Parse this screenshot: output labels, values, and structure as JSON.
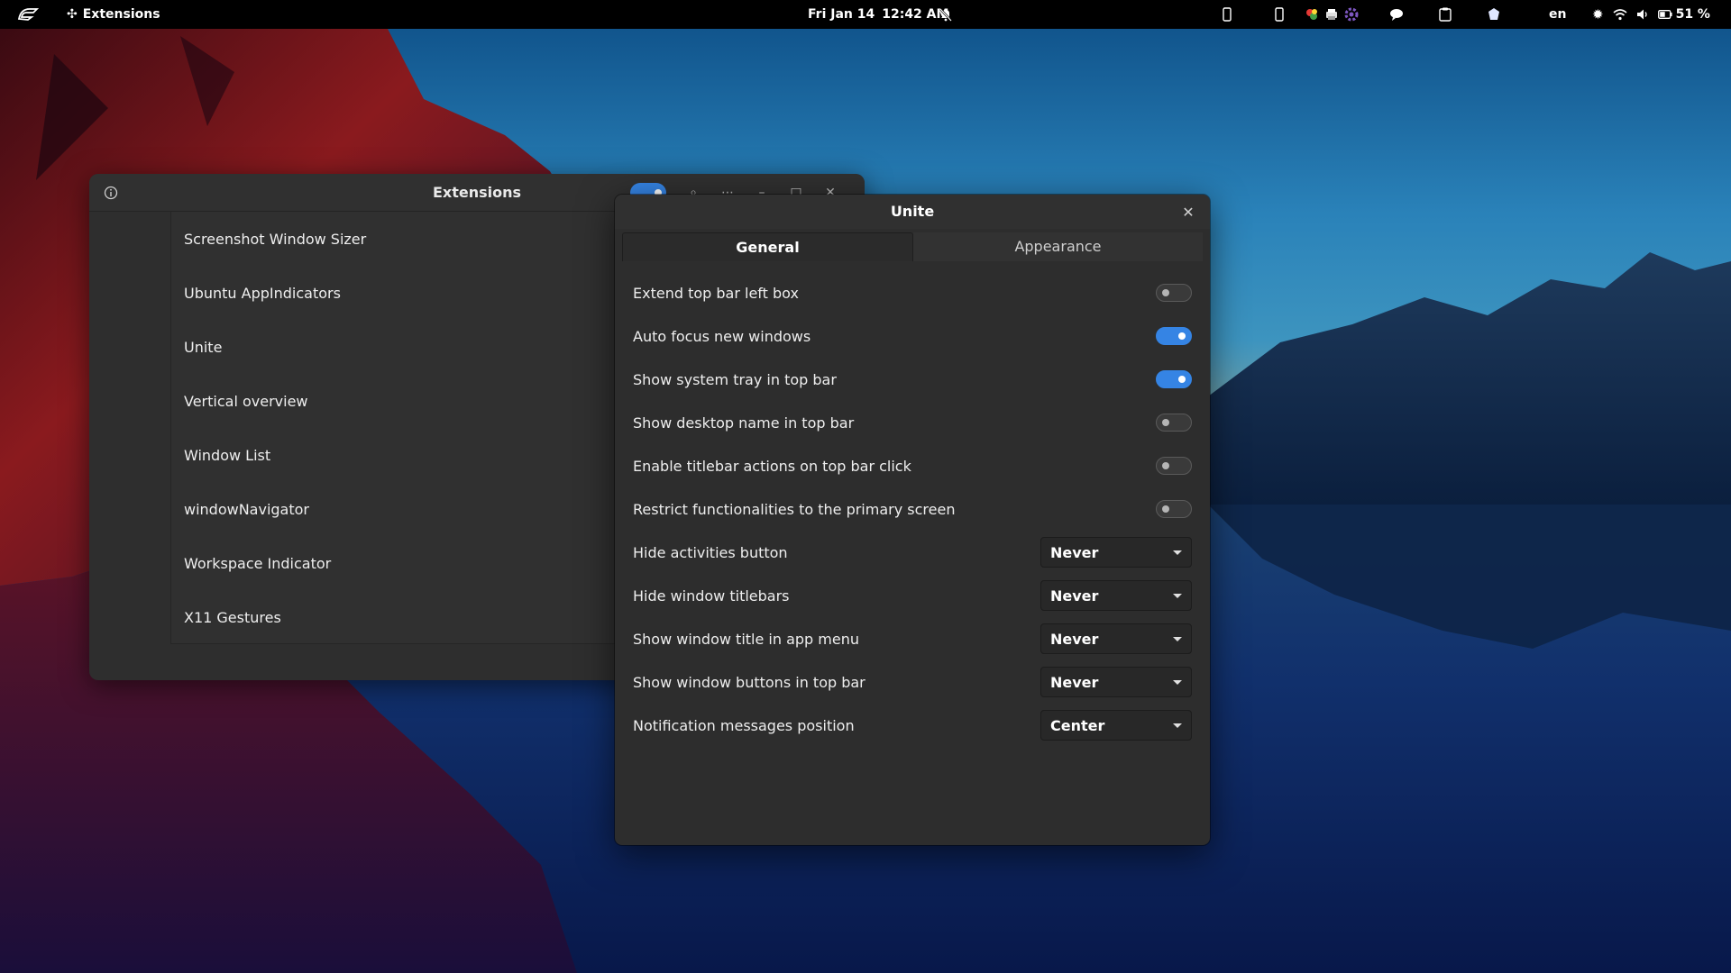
{
  "topbar": {
    "app_name": "Extensions",
    "date": "Fri Jan 14",
    "time": "12:42 AM",
    "language": "en",
    "battery": "51 %",
    "icons": [
      "activities-icon",
      "puzzle-icon",
      "bell-muted-icon",
      "phone-icon",
      "phone-icon",
      "color-picker-icon",
      "printer-icon",
      "gear-purple-icon",
      "chat-icon",
      "clipboard-icon",
      "shield-icon",
      "brightness-icon",
      "wifi-icon",
      "volume-icon",
      "battery-icon"
    ]
  },
  "extensions_window": {
    "title": "Extensions",
    "items": [
      {
        "label": "Screenshot Window Sizer"
      },
      {
        "label": "Ubuntu AppIndicators"
      },
      {
        "label": "Unite"
      },
      {
        "label": "Vertical overview"
      },
      {
        "label": "Window List"
      },
      {
        "label": "windowNavigator"
      },
      {
        "label": "Workspace Indicator"
      },
      {
        "label": "X11 Gestures"
      }
    ]
  },
  "unite_dialog": {
    "title": "Unite",
    "tabs": [
      {
        "label": "General",
        "active": true
      },
      {
        "label": "Appearance",
        "active": false
      }
    ],
    "switches": [
      {
        "label": "Extend top bar left box",
        "on": false
      },
      {
        "label": "Auto focus new windows",
        "on": true
      },
      {
        "label": "Show system tray in top bar",
        "on": true
      },
      {
        "label": "Show desktop name in top bar",
        "on": false
      },
      {
        "label": "Enable titlebar actions on top bar click",
        "on": false
      },
      {
        "label": "Restrict functionalities to the primary screen",
        "on": false
      }
    ],
    "dropdowns": [
      {
        "label": "Hide activities button",
        "value": "Never"
      },
      {
        "label": "Hide window titlebars",
        "value": "Never"
      },
      {
        "label": "Show window title in app menu",
        "value": "Never"
      },
      {
        "label": "Show window buttons in top bar",
        "value": "Never"
      },
      {
        "label": "Notification messages position",
        "value": "Center"
      }
    ]
  },
  "colors": {
    "accent": "#3584e4",
    "window_bg": "#2d2d2d",
    "topbar_bg": "#000000"
  }
}
